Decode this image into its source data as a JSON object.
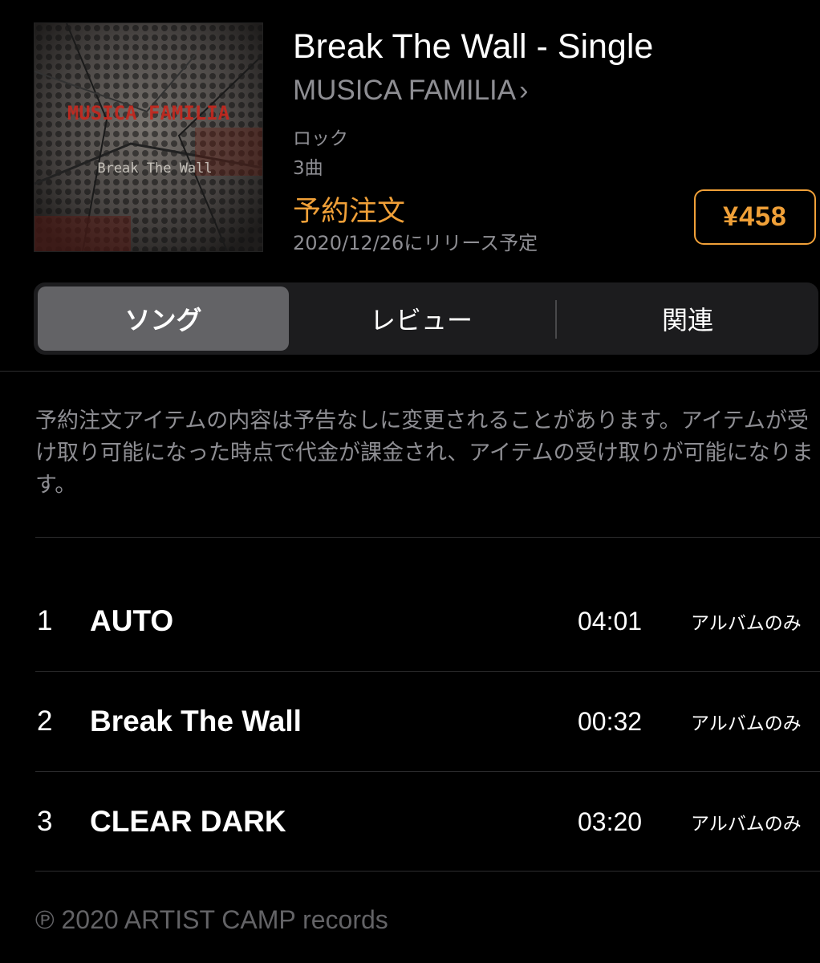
{
  "album": {
    "title": "Break The Wall - Single",
    "artist": "MUSICA FAMILIA",
    "artist_chevron": "›",
    "genre": "ロック",
    "track_count": "3曲",
    "preorder_label": "予約注文",
    "release_date": "2020/12/26にリリース予定",
    "price": "¥458",
    "artwork_text": {
      "band": "MUSICA FAMILIA",
      "title": "Break The Wall"
    }
  },
  "tabs": [
    {
      "label": "ソング",
      "selected": true
    },
    {
      "label": "レビュー",
      "selected": false
    },
    {
      "label": "関連",
      "selected": false
    }
  ],
  "notice": "予約注文アイテムの内容は予告なしに変更されることがあります。アイテムが受け取り可能になった時点で代金が課金され、アイテムの受け取りが可能になります。",
  "tracks": [
    {
      "number": "1",
      "title": "AUTO",
      "duration": "04:01",
      "availability": "アルバムのみ"
    },
    {
      "number": "2",
      "title": "Break The Wall",
      "duration": "00:32",
      "availability": "アルバムのみ"
    },
    {
      "number": "3",
      "title": "CLEAR DARK",
      "duration": "03:20",
      "availability": "アルバムのみ"
    }
  ],
  "copyright": "℗ 2020 ARTIST CAMP records",
  "colors": {
    "accent": "#f0a038",
    "secondary_text": "#8e8e93",
    "background": "#000000",
    "segment_selected": "#636366"
  }
}
